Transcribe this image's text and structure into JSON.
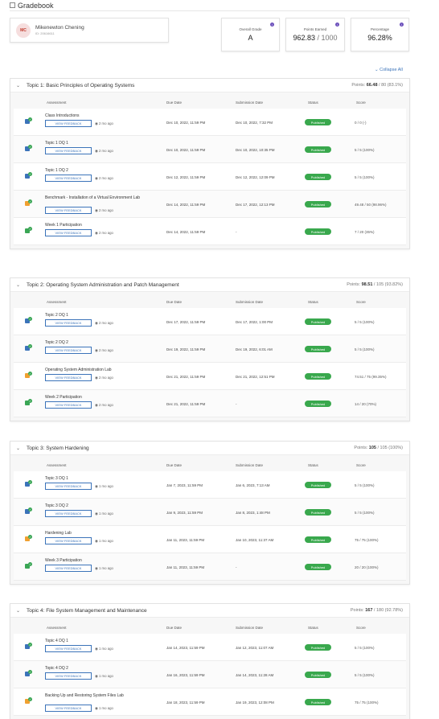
{
  "page": {
    "title": "Gradebook"
  },
  "student": {
    "initials": "MC",
    "name": "Mikenewton Chening",
    "id": "ID: 20616611"
  },
  "stats": [
    {
      "label": "Overall Grade",
      "value": "A",
      "sub": ""
    },
    {
      "label": "Points Earned",
      "value": "962.83",
      "sub": " / 1000"
    },
    {
      "label": "Percentage",
      "value": "96.28%",
      "sub": ""
    }
  ],
  "collapse_all_label": "Collapse All",
  "columns": {
    "assessment": "Assessment",
    "due": "Due Date",
    "submission": "Submission Date",
    "status": "Status",
    "score": "Score"
  },
  "feedback_label": "VIEW FEEDBACK",
  "colors": {
    "published": "#39a84d",
    "discussion": "#3b73b9",
    "participation": "#3aa655",
    "lab": "#f0a030",
    "accent": "#3b73b9"
  },
  "topics": [
    {
      "title": "Topic 1: Basic Principles of Operating Systems",
      "points_label": "Points:",
      "points_value": "66.48",
      "points_total": " / 80 (83.1%)",
      "rows": [
        {
          "icon": "discussion-icon",
          "name": "Class Introductions",
          "ago": "2 mo ago",
          "due": "Dec 10, 2022, 11:59 PM",
          "submitted": "Dec 10, 2022, 7:32 PM",
          "status": "Published",
          "score": "0 / 0 (-)"
        },
        {
          "icon": "discussion-icon",
          "name": "Topic 1 DQ 1",
          "ago": "2 mo ago",
          "due": "Dec 10, 2022, 11:59 PM",
          "submitted": "Dec 10, 2022, 10:35 PM",
          "status": "Published",
          "score": "5 / 5 (100%)"
        },
        {
          "icon": "discussion-icon",
          "name": "Topic 1 DQ 2",
          "ago": "2 mo ago",
          "due": "Dec 12, 2022, 11:59 PM",
          "submitted": "Dec 12, 2022, 12:09 PM",
          "status": "Published",
          "score": "5 / 5 (100%)"
        },
        {
          "icon": "lab-icon",
          "name": "Benchmark - Installation of a Virtual Environment Lab",
          "ago": "2 mo ago",
          "due": "Dec 14, 2022, 11:59 PM",
          "submitted": "Dec 17, 2022, 12:13 PM",
          "status": "Published",
          "score": "49.48 / 50 (98.96%)"
        },
        {
          "icon": "participation-icon",
          "name": "Week 1 Participation",
          "ago": "2 mo ago",
          "due": "Dec 14, 2022, 11:59 PM",
          "submitted": "-",
          "status": "Published",
          "score": "7 / 20 (35%)"
        }
      ]
    },
    {
      "title": "Topic 2: Operating System Administration and Patch Management",
      "points_label": "Points:",
      "points_value": "98.51",
      "points_total": " / 105 (93.82%)",
      "rows": [
        {
          "icon": "discussion-icon",
          "name": "Topic 2 DQ 1",
          "ago": "2 mo ago",
          "due": "Dec 17, 2022, 11:59 PM",
          "submitted": "Dec 17, 2022, 1:00 PM",
          "status": "Published",
          "score": "5 / 5 (100%)"
        },
        {
          "icon": "discussion-icon",
          "name": "Topic 2 DQ 2",
          "ago": "2 mo ago",
          "due": "Dec 19, 2022, 11:59 PM",
          "submitted": "Dec 19, 2022, 6:01 AM",
          "status": "Published",
          "score": "5 / 5 (100%)"
        },
        {
          "icon": "lab-icon",
          "name": "Operating System Administration Lab",
          "ago": "2 mo ago",
          "due": "Dec 21, 2022, 11:59 PM",
          "submitted": "Dec 21, 2022, 12:51 PM",
          "status": "Published",
          "score": "74.51 / 75 (99.35%)"
        },
        {
          "icon": "participation-icon",
          "name": "Week 2 Participation",
          "ago": "2 mo ago",
          "due": "Dec 21, 2022, 11:59 PM",
          "submitted": "-",
          "status": "Published",
          "score": "14 / 20 (70%)"
        }
      ]
    },
    {
      "title": "Topic 3: System Hardening",
      "points_label": "Points:",
      "points_value": "105",
      "points_total": " / 105 (100%)",
      "rows": [
        {
          "icon": "discussion-icon",
          "name": "Topic 3 DQ 1",
          "ago": "1 mo ago",
          "due": "Jan 7, 2023, 11:59 PM",
          "submitted": "Jan 6, 2023, 7:13 AM",
          "status": "Published",
          "score": "5 / 5 (100%)"
        },
        {
          "icon": "discussion-icon",
          "name": "Topic 3 DQ 2",
          "ago": "1 mo ago",
          "due": "Jan 9, 2023, 11:59 PM",
          "submitted": "Jan 8, 2023, 1:48 PM",
          "status": "Published",
          "score": "5 / 5 (100%)"
        },
        {
          "icon": "lab-icon",
          "name": "Hardening Lab",
          "ago": "1 mo ago",
          "due": "Jan 11, 2023, 11:59 PM",
          "submitted": "Jan 10, 2023, 11:37 AM",
          "status": "Published",
          "score": "75 / 75 (100%)"
        },
        {
          "icon": "participation-icon",
          "name": "Week 3 Participation",
          "ago": "1 mo ago",
          "due": "Jan 11, 2023, 11:59 PM",
          "submitted": "-",
          "status": "Published",
          "score": "20 / 20 (100%)"
        }
      ]
    },
    {
      "title": "Topic 4: File System Management and Maintenance",
      "points_label": "Points:",
      "points_value": "167",
      "points_total": " / 180 (92.78%)",
      "rows": [
        {
          "icon": "discussion-icon",
          "name": "Topic 4 DQ 1",
          "ago": "1 mo ago",
          "due": "Jan 14, 2023, 11:59 PM",
          "submitted": "Jan 12, 2023, 11:07 AM",
          "status": "Published",
          "score": "5 / 5 (100%)"
        },
        {
          "icon": "discussion-icon",
          "name": "Topic 4 DQ 2",
          "ago": "1 mo ago",
          "due": "Jan 16, 2023, 11:59 PM",
          "submitted": "Jan 14, 2023, 11:28 AM",
          "status": "Published",
          "score": "5 / 5 (100%)"
        },
        {
          "icon": "lab-icon",
          "name": "Backing Up and Restoring System Files Lab",
          "ago": "1 mo ago",
          "due": "Jan 18, 2023, 11:59 PM",
          "submitted": "Jan 19, 2023, 12:08 PM",
          "status": "Published",
          "score": "75 / 75 (100%)"
        }
      ]
    }
  ]
}
